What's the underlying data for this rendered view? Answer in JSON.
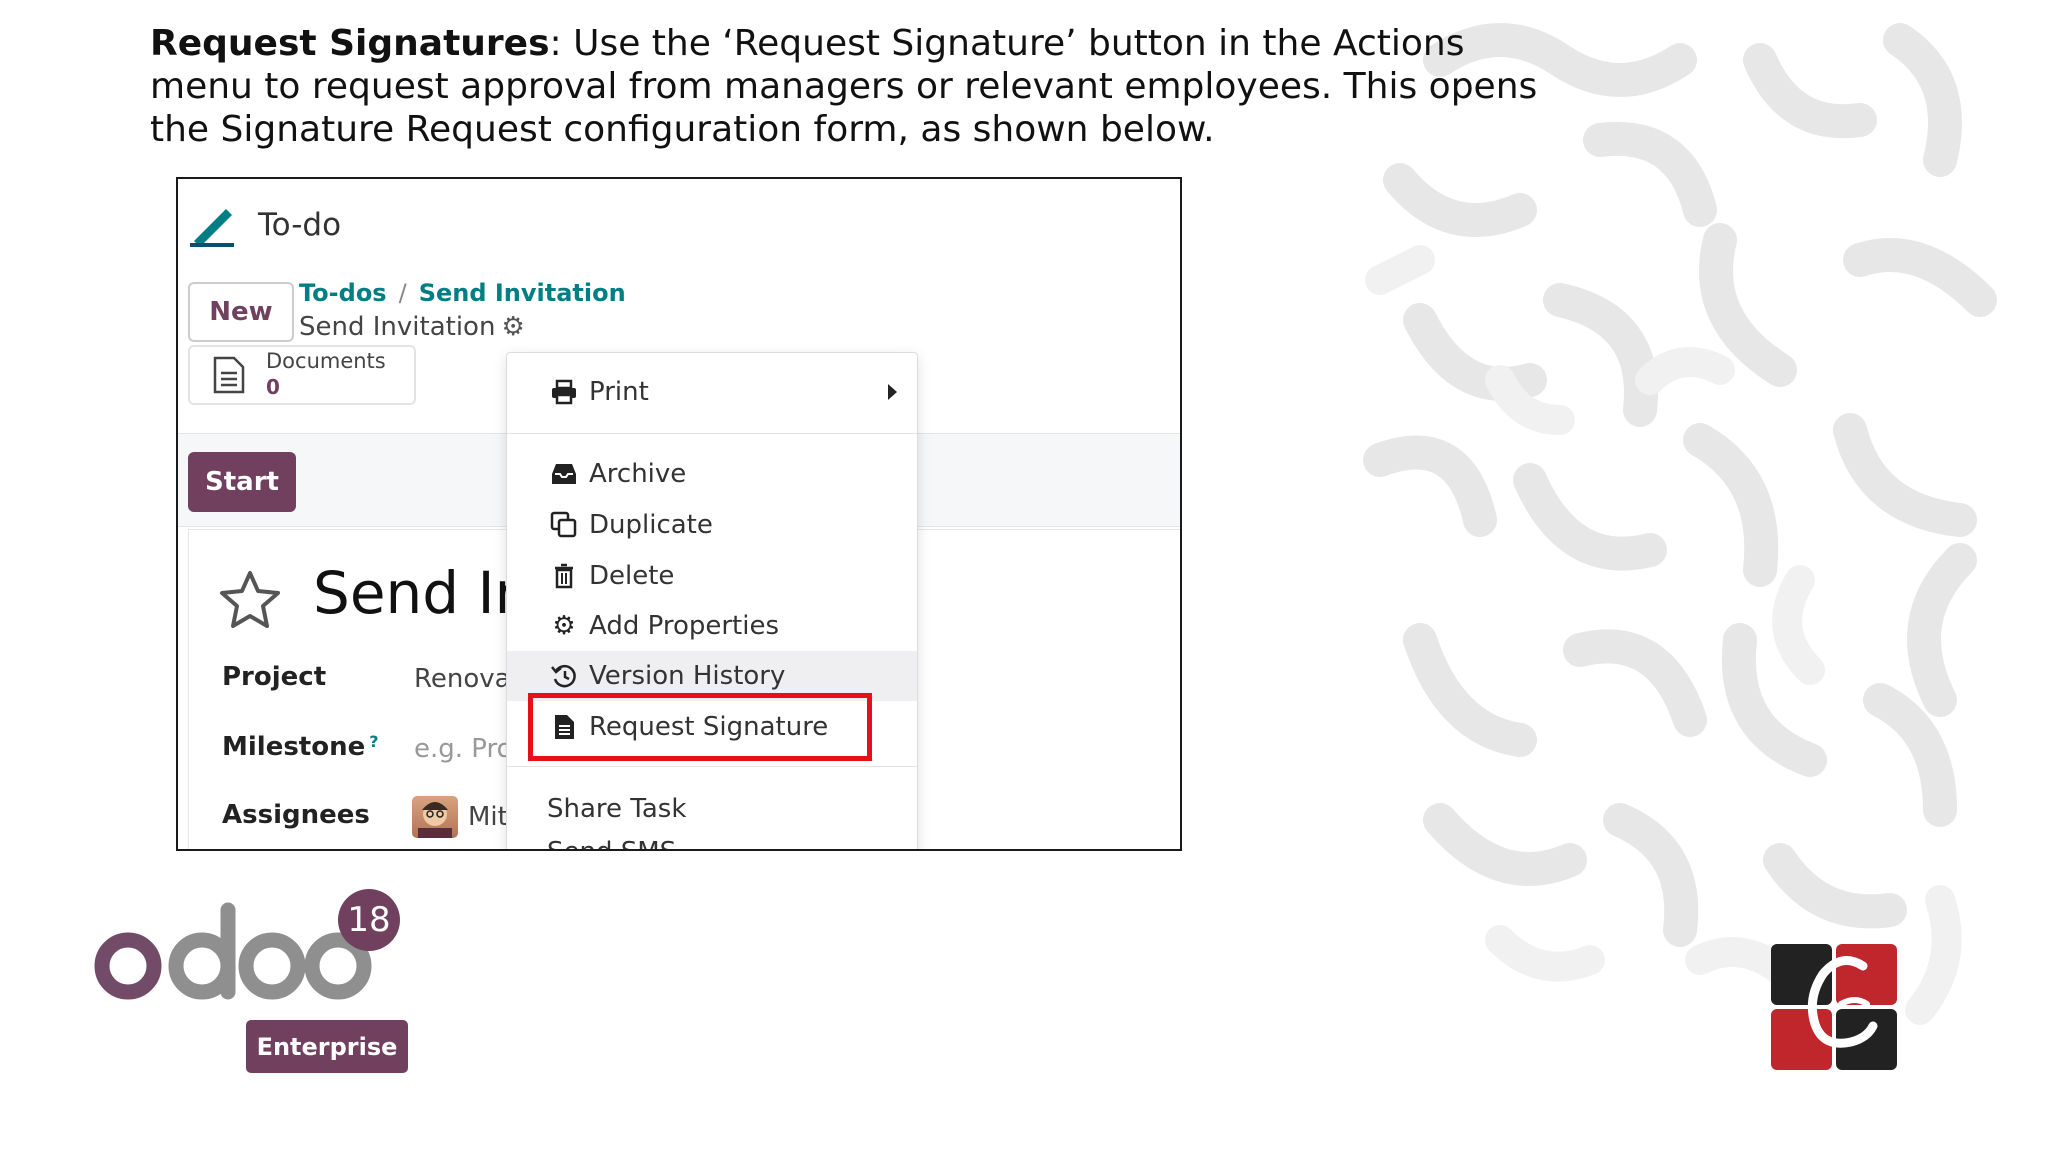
{
  "slide": {
    "heading_bold": "Request Signatures",
    "heading_rest": ": Use the ‘Request Signature’ button in the Actions menu to request approval from managers or relevant employees. This opens the Signature Request configuration form, as shown below."
  },
  "app": {
    "title": "To-do",
    "new_button": "New",
    "breadcrumb": {
      "parent": "To-dos",
      "separator": "/",
      "child": "Send Invitation",
      "current": "Send Invitation"
    },
    "documents": {
      "label": "Documents",
      "count": "0"
    },
    "start_button": "Start",
    "task_title": "Send Invitation",
    "fields": [
      {
        "label": "Project",
        "value": "Renovation"
      },
      {
        "label": "Milestone",
        "placeholder": "e.g. Product Launch",
        "help": "?"
      },
      {
        "label": "Assignees",
        "value": "Mitchell Admin"
      }
    ]
  },
  "menu": {
    "items": [
      {
        "label": "Print",
        "icon": "printer-icon"
      },
      {
        "label": "Archive",
        "icon": "inbox-icon"
      },
      {
        "label": "Duplicate",
        "icon": "copy-icon"
      },
      {
        "label": "Delete",
        "icon": "trash-icon"
      },
      {
        "label": "Add Properties",
        "icon": "cogs-icon"
      },
      {
        "label": "Version History",
        "icon": "history-icon"
      },
      {
        "label": "Request Signature",
        "icon": "file-text-icon"
      },
      {
        "label": "Share Task"
      },
      {
        "label": "Send SMS"
      }
    ],
    "highlight_color": "#e5101a"
  },
  "logo": {
    "brand": "odoo",
    "version": "18",
    "edition": "Enterprise"
  },
  "colors": {
    "brand": "#71405e",
    "link": "#017e84"
  }
}
